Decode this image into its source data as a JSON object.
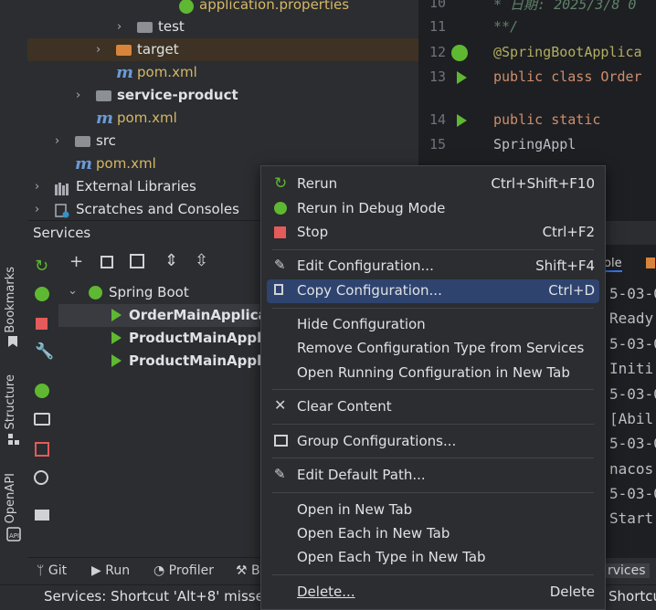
{
  "project_tree": {
    "partial_top_file": "application.properties",
    "rows": [
      {
        "label": "test",
        "kind": "folder"
      },
      {
        "label": "target",
        "kind": "folder-orange"
      },
      {
        "label": "pom.xml",
        "kind": "maven"
      },
      {
        "label": "service-product",
        "kind": "module"
      },
      {
        "label": "pom.xml",
        "kind": "maven"
      },
      {
        "label": "src",
        "kind": "folder"
      },
      {
        "label": "pom.xml",
        "kind": "maven"
      },
      {
        "label": "External Libraries",
        "kind": "libraries"
      },
      {
        "label": "Scratches and Consoles",
        "kind": "scratches"
      }
    ]
  },
  "editor": {
    "lines": [
      {
        "num": "10",
        "text": " * 日期: 2025/3/8 0"
      },
      {
        "num": "11",
        "text": " **/"
      },
      {
        "num": "12",
        "text": "@SpringBootApplica"
      },
      {
        "num": "13",
        "text": "public class Order"
      },
      {
        "num": "14",
        "text": "  public static"
      },
      {
        "num": "15",
        "text": "    SpringAppl"
      }
    ]
  },
  "left_stripe": {
    "bookmarks": "Bookmarks",
    "structure": "Structure",
    "openapi": "OpenAPI"
  },
  "services": {
    "title": "Services",
    "root": "Spring Boot",
    "items": [
      {
        "label": "OrderMainApplicat",
        "selected": true
      },
      {
        "label": "ProductMainApplic",
        "selected": false
      },
      {
        "label": "ProductMainApplic",
        "selected": false
      }
    ]
  },
  "console": {
    "tab": "ole",
    "lines": [
      "5-03-0",
      "Ready",
      "5-03-0",
      "Initi",
      "5-03-0",
      "[Abil",
      "5-03-0",
      "nacos",
      "5-03-0",
      "Start"
    ],
    "bottom_tab": "rvices"
  },
  "tool_windows": {
    "git": "Git",
    "run": "Run",
    "profiler": "Profiler",
    "build": "B"
  },
  "status": {
    "text": "Services: Shortcut 'Alt+8' missed",
    "right": "Shortcu"
  },
  "context_menu": {
    "items": [
      {
        "label": "Rerun",
        "shortcut": "Ctrl+Shift+F10",
        "icon": "rerun-icon"
      },
      {
        "label": "Rerun in Debug Mode",
        "shortcut": "",
        "icon": "debug-icon"
      },
      {
        "label": "Stop",
        "shortcut": "Ctrl+F2",
        "icon": "stop-icon"
      },
      {
        "label": "Edit Configuration...",
        "shortcut": "Shift+F4",
        "icon": "pencil-icon"
      },
      {
        "label": "Copy Configuration...",
        "shortcut": "Ctrl+D",
        "icon": "copy-icon"
      },
      {
        "label": "Hide Configuration",
        "shortcut": "",
        "icon": ""
      },
      {
        "label": "Remove Configuration Type from Services",
        "shortcut": "",
        "icon": ""
      },
      {
        "label": "Open Running Configuration in New Tab",
        "shortcut": "",
        "icon": ""
      },
      {
        "label": "Clear Content",
        "shortcut": "",
        "icon": "close-icon"
      },
      {
        "label": "Group Configurations...",
        "shortcut": "",
        "icon": "group-icon"
      },
      {
        "label": "Edit Default Path...",
        "shortcut": "",
        "icon": "pencil-icon"
      },
      {
        "label": "Open in New Tab",
        "shortcut": "",
        "icon": ""
      },
      {
        "label": "Open Each in New Tab",
        "shortcut": "",
        "icon": ""
      },
      {
        "label": "Open Each Type in New Tab",
        "shortcut": "",
        "icon": ""
      },
      {
        "label": "Delete...",
        "shortcut": "Delete",
        "icon": ""
      }
    ]
  },
  "colors": {
    "menu_highlight": "#2e436e",
    "run_green": "#5fb832",
    "stop_red": "#e55a5a",
    "keyword": "#cf8e6d",
    "annotation": "#b3ae60"
  }
}
